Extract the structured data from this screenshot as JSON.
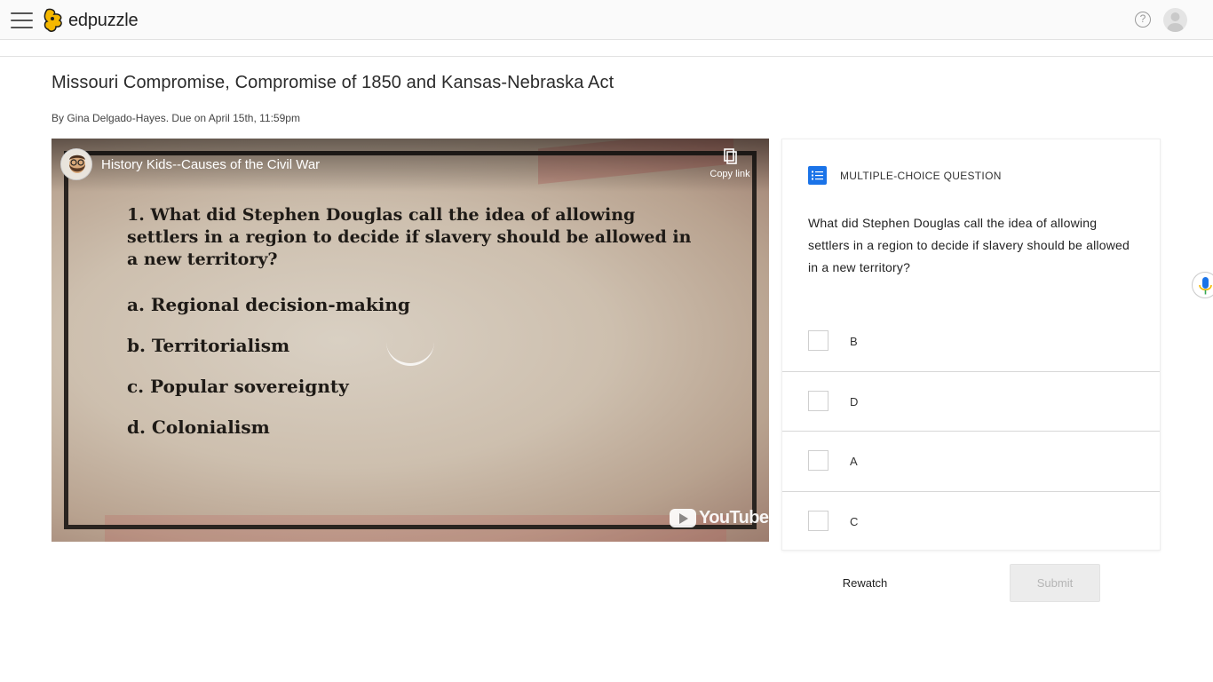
{
  "app": {
    "name": "edpuzzle"
  },
  "header": {
    "help_glyph": "?"
  },
  "assignment": {
    "title": "Missouri Compromise, Compromise of 1850 and Kansas-Nebraska Act",
    "byline": "By Gina Delgado-Hayes. Due on April 15th, 11:59pm"
  },
  "video": {
    "channel_title": "History Kids--Causes of the Civil War",
    "copy_link_label": "Copy link",
    "youtube_label": "YouTube",
    "slide": {
      "question": "1. What did Stephen Douglas call the idea of allowing settlers in a region to decide if slavery should be allowed in a new territory?",
      "options": [
        "a. Regional decision-making",
        "b. Territorialism",
        "c. Popular sovereignty",
        "d. Colonialism"
      ]
    }
  },
  "question_panel": {
    "type_label": "MULTIPLE-CHOICE QUESTION",
    "question_text": "What did Stephen Douglas call the idea of allowing settlers in a region to decide if slavery should be allowed in a new territory?",
    "options": [
      {
        "label": "B"
      },
      {
        "label": "D"
      },
      {
        "label": "A"
      },
      {
        "label": "C"
      }
    ]
  },
  "actions": {
    "rewatch_label": "Rewatch",
    "submit_label": "Submit"
  },
  "colors": {
    "accent_blue": "#1a73e8",
    "logo_yellow": "#f5b800",
    "submit_disabled_bg": "#ececec"
  }
}
